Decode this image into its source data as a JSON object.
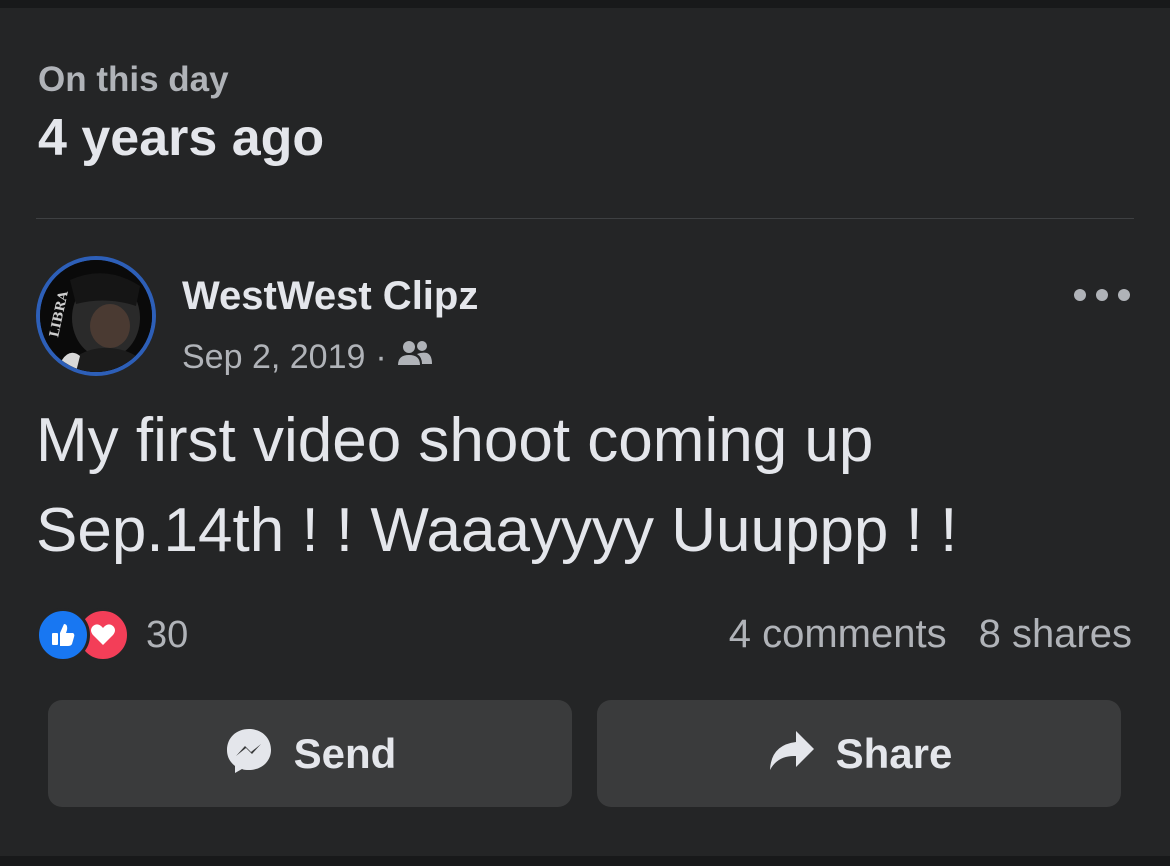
{
  "header": {
    "subtitle": "On this day",
    "title": "4 years ago"
  },
  "post": {
    "author": "WestWest Clipz",
    "avatar_text": "LIBRA",
    "date": "Sep 2, 2019",
    "separator": "·",
    "audience_icon": "friends-icon",
    "text": "My first video shoot coming up Sep.14th ! ! Waaayyyy Uuuppp ! !",
    "reactions": {
      "icons": [
        "like-icon",
        "love-icon"
      ],
      "count": "30"
    },
    "comments": "4 comments",
    "shares": "8 shares"
  },
  "actions": {
    "send_label": "Send",
    "share_label": "Share"
  },
  "colors": {
    "background": "#242526",
    "text_primary": "#e4e6eb",
    "text_secondary": "#b0b3b8",
    "button_bg": "#3a3b3c",
    "like_blue": "#1877f2",
    "love_red": "#f33e58",
    "avatar_ring": "#2d5fb8"
  }
}
